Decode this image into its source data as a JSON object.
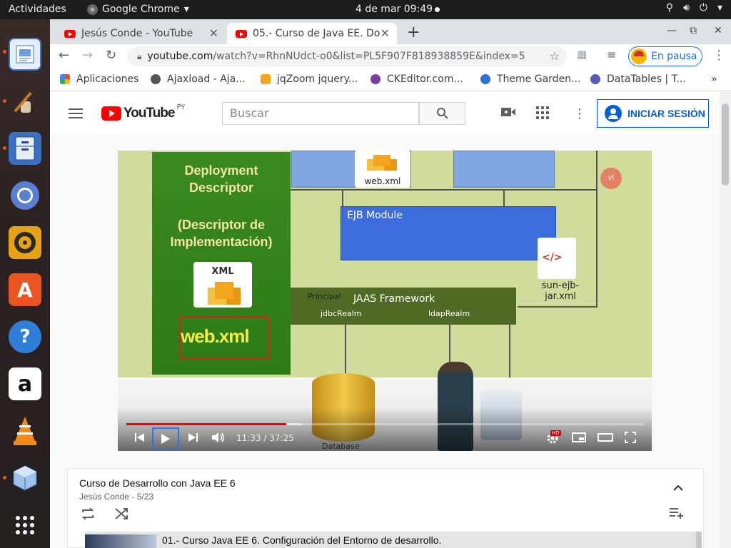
{
  "system": {
    "activities": "Actividades",
    "app_name": "Google Chrome",
    "clock": "4 de mar  09:49"
  },
  "dock": {
    "apps": [
      "photo-viewer-icon",
      "image-editor-icon",
      "file-manager-icon",
      "chromium-icon",
      "music-player-icon",
      "software-store-icon",
      "help-icon",
      "amazon-icon",
      "vlc-icon",
      "virtualbox-icon",
      "app-grid-icon"
    ]
  },
  "browser": {
    "tabs": [
      {
        "title": "Jesús Conde - YouTube"
      },
      {
        "title": "05.- Curso de Java EE. Do"
      }
    ],
    "url_host": "youtube.com",
    "url_rest": "/watch?v=RhnNUdct-o0&list=PL5F907F818938859E&index=5",
    "profile_label": "En pausa",
    "bookmarks": [
      {
        "label": "Aplicaciones",
        "color": "#4285f4"
      },
      {
        "label": "Ajaxload - Aja...",
        "color": "#555555"
      },
      {
        "label": "jqZoom jquery...",
        "color": "#f4a520"
      },
      {
        "label": "CKEditor.com...",
        "color": "#7b3fa0"
      },
      {
        "label": "Theme Garden...",
        "color": "#2a6fd6"
      },
      {
        "label": "DataTables | T...",
        "color": "#5a5ab0"
      }
    ],
    "bookmarks_more": "»"
  },
  "youtube": {
    "logo_word": "YouTube",
    "country_code": "PY",
    "search_placeholder": "Buscar",
    "signin_label": "INICIAR SESIÓN"
  },
  "video": {
    "slide": {
      "title_lines": [
        "Deployment",
        "Descriptor",
        "(Descriptor de",
        "Implementación)"
      ],
      "xml_label": "XML",
      "highlight_text": "web.xml",
      "top_file": "web.xml",
      "ejb_module": "EJB Module",
      "jaas": "JAAS Framework",
      "principal": "Principal",
      "jdbc_realm": "jdbcRealm",
      "ldap_realm": "ldapRealm",
      "sun_ejb": "sun-ejb-jar.xml",
      "code_glyph": "</>",
      "database": "Database"
    },
    "current_time": "11:33",
    "duration": "37:25",
    "played_fraction": 0.309,
    "buffered_fraction": 0.34,
    "hd_badge": "HD"
  },
  "playlist": {
    "title": "Curso de Desarrollo con Java EE 6",
    "subtitle": "Jesús Conde - 5/23",
    "first_item": "01.- Curso Java EE 6. Configuración del Entorno de desarrollo."
  }
}
